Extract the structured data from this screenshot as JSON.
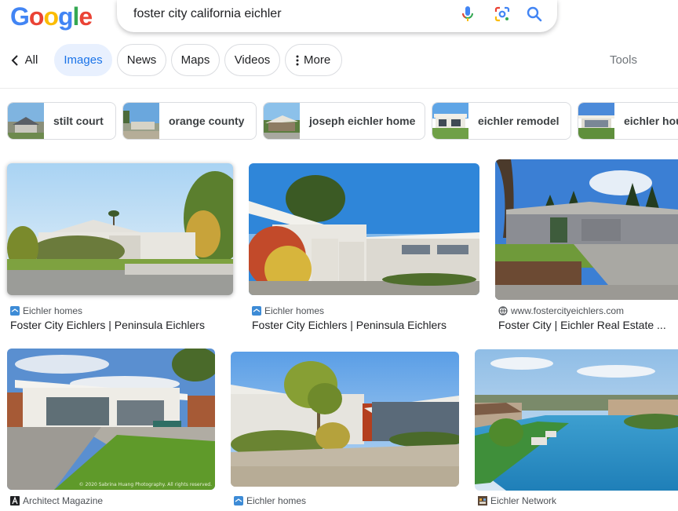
{
  "logo": {
    "letters": [
      "G",
      "o",
      "o",
      "g",
      "l",
      "e"
    ],
    "colors": [
      "#4285f4",
      "#ea4335",
      "#fbbc05",
      "#4285f4",
      "#34a853",
      "#ea4335"
    ]
  },
  "search": {
    "query": "foster city california eichler"
  },
  "icons": {
    "mic": "mic-icon",
    "lens": "lens-icon",
    "search": "search-icon",
    "back": "chevron-left-icon",
    "more": "more-vert-icon"
  },
  "tabs": {
    "all": "All",
    "images": "Images",
    "news": "News",
    "maps": "Maps",
    "videos": "Videos",
    "more": "More",
    "tools": "Tools"
  },
  "chips": [
    {
      "label": "stilt court"
    },
    {
      "label": "orange county"
    },
    {
      "label": "joseph eichler home"
    },
    {
      "label": "eichler remodel"
    },
    {
      "label": "eichler hou"
    }
  ],
  "results": [
    {
      "source": "Eichler homes",
      "title": "Foster City Eichlers | Peninsula Eichlers"
    },
    {
      "source": "Eichler homes",
      "title": "Foster City Eichlers | Peninsula Eichlers"
    },
    {
      "source": "www.fostercityeichlers.com",
      "title": "Foster City | Eichler Real Estate ..."
    },
    {
      "source": "Architect Magazine",
      "title": "",
      "watermark": "© 2020 Sabrina Huang Photography. All rights reserved."
    },
    {
      "source": "Eichler homes",
      "title": ""
    },
    {
      "source": "Eichler Network",
      "title": ""
    }
  ],
  "colors": {
    "accent": "#1a73e8",
    "active_tab_bg": "#e8f0fe",
    "border": "#dadce0"
  }
}
